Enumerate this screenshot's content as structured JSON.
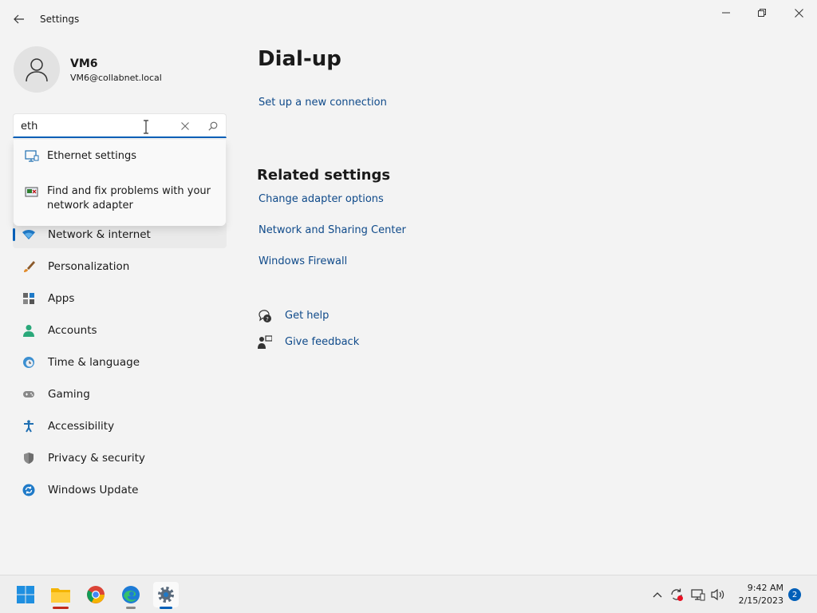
{
  "window": {
    "title": "Settings"
  },
  "user": {
    "name": "VM6",
    "email": "VM6@collabnet.local"
  },
  "search": {
    "value": "eth",
    "suggestions": [
      {
        "label": "Ethernet settings",
        "icon": "ethernet-monitor-icon"
      },
      {
        "label": "Find and fix problems with your network adapter",
        "icon": "troubleshoot-icon"
      }
    ]
  },
  "nav": {
    "items": [
      {
        "label": "Network & internet",
        "icon": "wifi-icon",
        "selected": true
      },
      {
        "label": "Personalization",
        "icon": "brush-icon"
      },
      {
        "label": "Apps",
        "icon": "apps-icon"
      },
      {
        "label": "Accounts",
        "icon": "person-icon"
      },
      {
        "label": "Time & language",
        "icon": "clock-globe-icon"
      },
      {
        "label": "Gaming",
        "icon": "gamepad-icon"
      },
      {
        "label": "Accessibility",
        "icon": "accessibility-icon"
      },
      {
        "label": "Privacy & security",
        "icon": "shield-icon"
      },
      {
        "label": "Windows Update",
        "icon": "update-icon"
      }
    ]
  },
  "main": {
    "title": "Dial-up",
    "setup_link": "Set up a new connection",
    "related_title": "Related settings",
    "related_links": [
      "Change adapter options",
      "Network and Sharing Center",
      "Windows Firewall"
    ],
    "help_links": [
      {
        "label": "Get help",
        "icon": "help-icon"
      },
      {
        "label": "Give feedback",
        "icon": "feedback-icon"
      }
    ]
  },
  "taskbar": {
    "apps": [
      "start-icon",
      "file-explorer-icon",
      "chrome-icon",
      "edge-icon",
      "settings-icon"
    ],
    "time": "9:42 AM",
    "date": "2/15/2023",
    "notifications": "2"
  },
  "colors": {
    "accent": "#005fb8",
    "link": "#0f4a8a",
    "background": "#f3f3f3"
  }
}
